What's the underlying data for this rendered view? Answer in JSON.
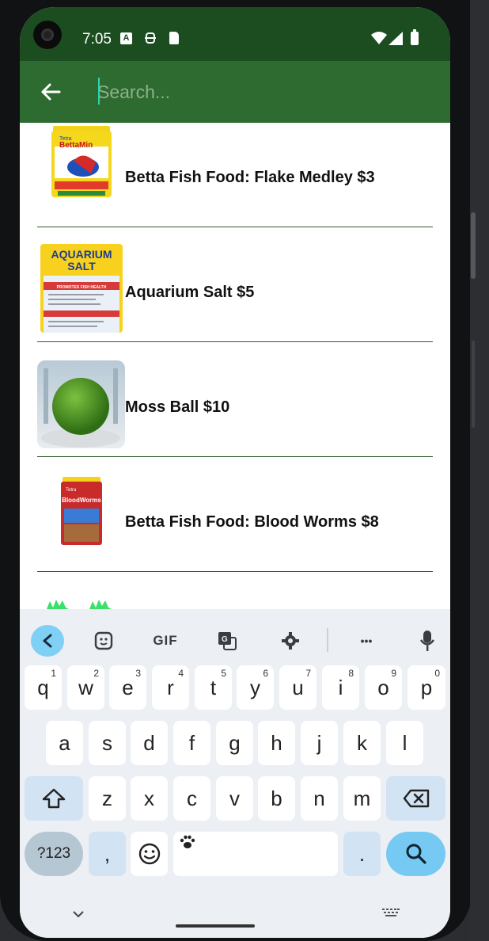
{
  "status_bar": {
    "time": "7:05",
    "badge": "A"
  },
  "search": {
    "placeholder": "Search..."
  },
  "products": [
    {
      "label": "Betta Fish Food: Flake Medley $3",
      "pack_line1": "Tetra",
      "pack_line2": "BettaMin"
    },
    {
      "label": "Aquarium Salt $5",
      "pack_line1": "AQUARIUM",
      "pack_line2": "SALT",
      "pack_line3": "PROMOTES FISH HEALTH"
    },
    {
      "label": "Moss Ball $10"
    },
    {
      "label": "Betta Fish Food: Blood Worms $8",
      "pack_line1": "Tetra",
      "pack_line2": "BloodWorms"
    }
  ],
  "keyboard": {
    "toolbar": {
      "gif": "GIF",
      "more": "•••"
    },
    "row1": [
      {
        "k": "q",
        "s": "1"
      },
      {
        "k": "w",
        "s": "2"
      },
      {
        "k": "e",
        "s": "3"
      },
      {
        "k": "r",
        "s": "4"
      },
      {
        "k": "t",
        "s": "5"
      },
      {
        "k": "y",
        "s": "6"
      },
      {
        "k": "u",
        "s": "7"
      },
      {
        "k": "i",
        "s": "8"
      },
      {
        "k": "o",
        "s": "9"
      },
      {
        "k": "p",
        "s": "0"
      }
    ],
    "row2": [
      "a",
      "s",
      "d",
      "f",
      "g",
      "h",
      "j",
      "k",
      "l"
    ],
    "row3": [
      "z",
      "x",
      "c",
      "v",
      "b",
      "n",
      "m"
    ],
    "symbols_label": "?123",
    "comma": ",",
    "period": "."
  }
}
